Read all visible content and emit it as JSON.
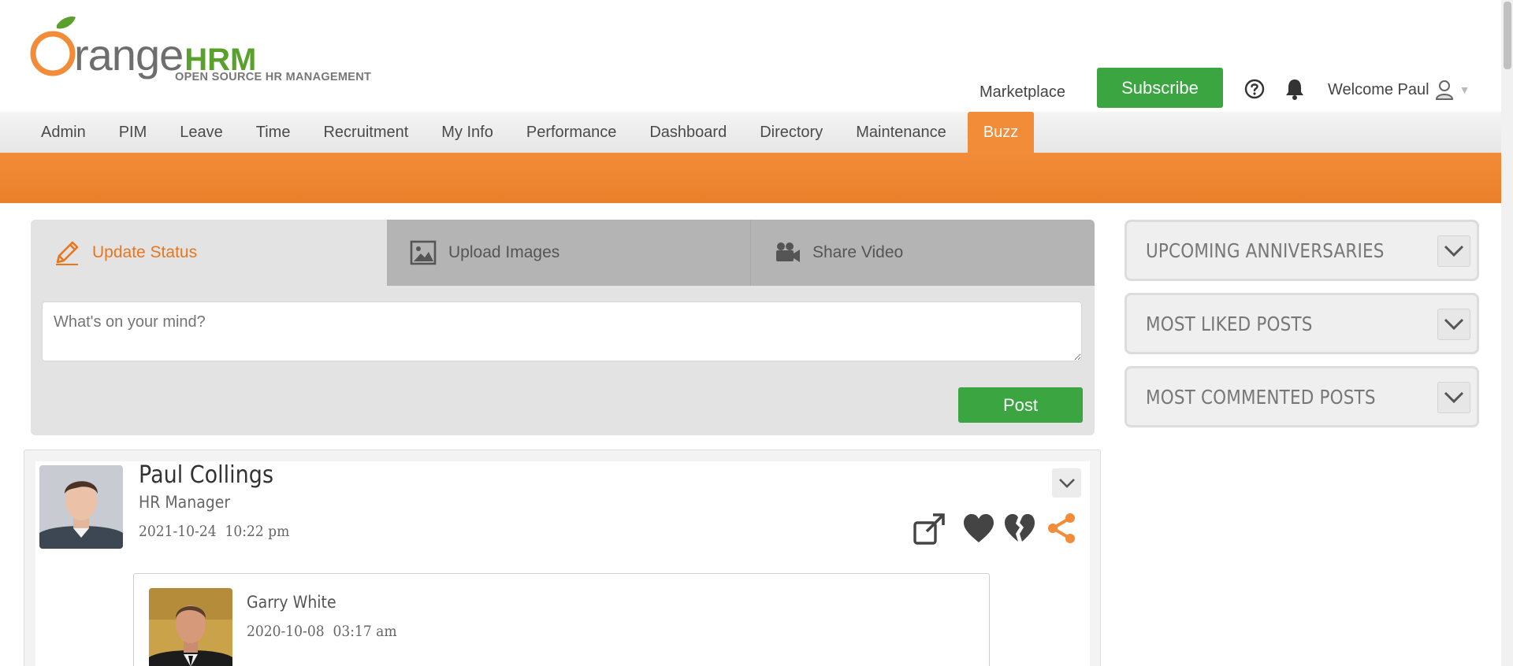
{
  "app": {
    "logo_main": "range",
    "logo_hrm": "HRM",
    "logo_tagline": "OPEN SOURCE HR MANAGEMENT",
    "brand_orange": "#f28c38",
    "brand_green": "#3aa541"
  },
  "header": {
    "marketplace_label": "Marketplace",
    "subscribe_label": "Subscribe",
    "welcome_label": "Welcome Paul",
    "help_icon": "help-circle-icon",
    "notifications_icon": "bell-icon",
    "user_icon": "user-icon"
  },
  "nav": {
    "items": [
      {
        "label": "Admin"
      },
      {
        "label": "PIM"
      },
      {
        "label": "Leave"
      },
      {
        "label": "Time"
      },
      {
        "label": "Recruitment"
      },
      {
        "label": "My Info"
      },
      {
        "label": "Performance"
      },
      {
        "label": "Dashboard"
      },
      {
        "label": "Directory"
      },
      {
        "label": "Maintenance"
      },
      {
        "label": "Buzz"
      }
    ],
    "active": "Buzz"
  },
  "composer": {
    "tabs": [
      {
        "label": "Update Status",
        "icon": "pencil-icon"
      },
      {
        "label": "Upload Images",
        "icon": "image-icon"
      },
      {
        "label": "Share Video",
        "icon": "video-camera-icon"
      }
    ],
    "placeholder": "What's on your mind?",
    "post_label": "Post"
  },
  "post": {
    "author": "Paul Collings",
    "role": "HR Manager",
    "date": "2021-10-24  10:22 pm",
    "actions": [
      "share-out-icon",
      "heart-icon",
      "broken-heart-icon",
      "share-icon"
    ],
    "shared": {
      "author": "Garry White",
      "date": "2020-10-08  03:17 am"
    }
  },
  "widgets": [
    {
      "title": "UPCOMING ANNIVERSARIES"
    },
    {
      "title": "MOST LIKED POSTS"
    },
    {
      "title": "MOST COMMENTED POSTS"
    }
  ]
}
